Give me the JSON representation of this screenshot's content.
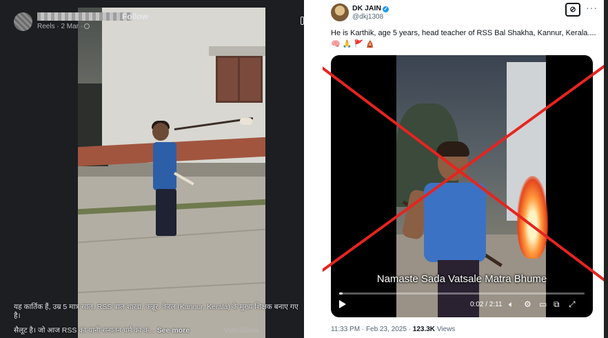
{
  "facebook_post": {
    "follow_label": "Follow",
    "meta": "Reels · 2 Mar ·",
    "caption_line1": "यह कार्तिक हैं, उम्र 5 मात्र साल, RSS बाल शाखा, कन्नूर, केरल (Kannur, Kerala) के मुख्य शिक्षक बनाए गए है।",
    "caption_line2": "सैलूट है। जो आज RSS का यानी सनातन धर्म का क...",
    "see_more_label": "See more",
    "watermark": "VideoShow"
  },
  "tweet": {
    "author_name": "DK JAIN",
    "author_handle": "@dkj1308",
    "grok_icon": "⊘",
    "menu_label": "···",
    "text": "He is Karthik, age 5 years, head teacher of RSS Bal Shakha, Kannur, Kerala.... 🧠 🙏 🚩 🛕",
    "video_subtitle": "Namaste Sada Vatsale Matra Bhume",
    "video_time": "0:02 / 2:11",
    "video_progress": 0.015,
    "timestamp": "11:33 PM · Feb 23, 2025 ·",
    "views_count": "123.3K",
    "views_label": "Views"
  },
  "overlay": {
    "cross_color": "#e8231f"
  }
}
